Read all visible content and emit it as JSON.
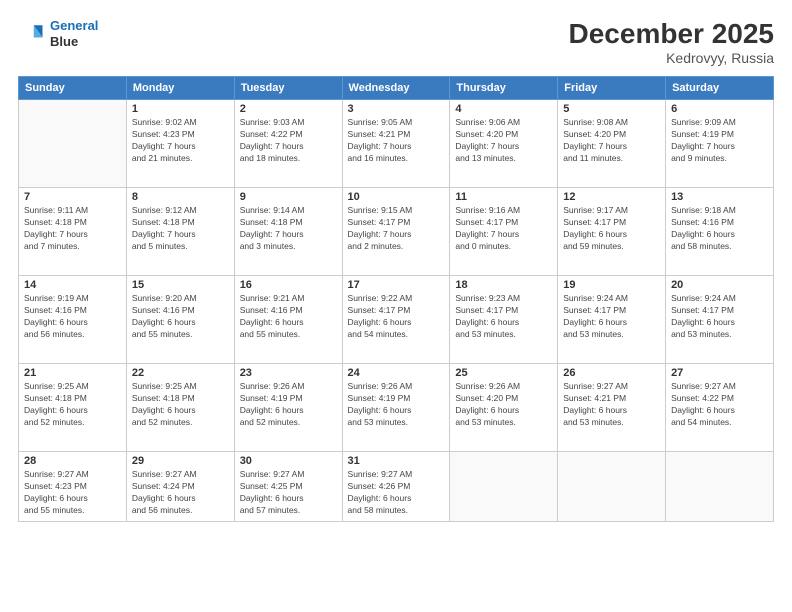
{
  "logo": {
    "line1": "General",
    "line2": "Blue"
  },
  "title": "December 2025",
  "subtitle": "Kedrovyy, Russia",
  "weekdays": [
    "Sunday",
    "Monday",
    "Tuesday",
    "Wednesday",
    "Thursday",
    "Friday",
    "Saturday"
  ],
  "weeks": [
    [
      {
        "day": "",
        "info": ""
      },
      {
        "day": "1",
        "info": "Sunrise: 9:02 AM\nSunset: 4:23 PM\nDaylight: 7 hours\nand 21 minutes."
      },
      {
        "day": "2",
        "info": "Sunrise: 9:03 AM\nSunset: 4:22 PM\nDaylight: 7 hours\nand 18 minutes."
      },
      {
        "day": "3",
        "info": "Sunrise: 9:05 AM\nSunset: 4:21 PM\nDaylight: 7 hours\nand 16 minutes."
      },
      {
        "day": "4",
        "info": "Sunrise: 9:06 AM\nSunset: 4:20 PM\nDaylight: 7 hours\nand 13 minutes."
      },
      {
        "day": "5",
        "info": "Sunrise: 9:08 AM\nSunset: 4:20 PM\nDaylight: 7 hours\nand 11 minutes."
      },
      {
        "day": "6",
        "info": "Sunrise: 9:09 AM\nSunset: 4:19 PM\nDaylight: 7 hours\nand 9 minutes."
      }
    ],
    [
      {
        "day": "7",
        "info": "Sunrise: 9:11 AM\nSunset: 4:18 PM\nDaylight: 7 hours\nand 7 minutes."
      },
      {
        "day": "8",
        "info": "Sunrise: 9:12 AM\nSunset: 4:18 PM\nDaylight: 7 hours\nand 5 minutes."
      },
      {
        "day": "9",
        "info": "Sunrise: 9:14 AM\nSunset: 4:18 PM\nDaylight: 7 hours\nand 3 minutes."
      },
      {
        "day": "10",
        "info": "Sunrise: 9:15 AM\nSunset: 4:17 PM\nDaylight: 7 hours\nand 2 minutes."
      },
      {
        "day": "11",
        "info": "Sunrise: 9:16 AM\nSunset: 4:17 PM\nDaylight: 7 hours\nand 0 minutes."
      },
      {
        "day": "12",
        "info": "Sunrise: 9:17 AM\nSunset: 4:17 PM\nDaylight: 6 hours\nand 59 minutes."
      },
      {
        "day": "13",
        "info": "Sunrise: 9:18 AM\nSunset: 4:16 PM\nDaylight: 6 hours\nand 58 minutes."
      }
    ],
    [
      {
        "day": "14",
        "info": "Sunrise: 9:19 AM\nSunset: 4:16 PM\nDaylight: 6 hours\nand 56 minutes."
      },
      {
        "day": "15",
        "info": "Sunrise: 9:20 AM\nSunset: 4:16 PM\nDaylight: 6 hours\nand 55 minutes."
      },
      {
        "day": "16",
        "info": "Sunrise: 9:21 AM\nSunset: 4:16 PM\nDaylight: 6 hours\nand 55 minutes."
      },
      {
        "day": "17",
        "info": "Sunrise: 9:22 AM\nSunset: 4:17 PM\nDaylight: 6 hours\nand 54 minutes."
      },
      {
        "day": "18",
        "info": "Sunrise: 9:23 AM\nSunset: 4:17 PM\nDaylight: 6 hours\nand 53 minutes."
      },
      {
        "day": "19",
        "info": "Sunrise: 9:24 AM\nSunset: 4:17 PM\nDaylight: 6 hours\nand 53 minutes."
      },
      {
        "day": "20",
        "info": "Sunrise: 9:24 AM\nSunset: 4:17 PM\nDaylight: 6 hours\nand 53 minutes."
      }
    ],
    [
      {
        "day": "21",
        "info": "Sunrise: 9:25 AM\nSunset: 4:18 PM\nDaylight: 6 hours\nand 52 minutes."
      },
      {
        "day": "22",
        "info": "Sunrise: 9:25 AM\nSunset: 4:18 PM\nDaylight: 6 hours\nand 52 minutes."
      },
      {
        "day": "23",
        "info": "Sunrise: 9:26 AM\nSunset: 4:19 PM\nDaylight: 6 hours\nand 52 minutes."
      },
      {
        "day": "24",
        "info": "Sunrise: 9:26 AM\nSunset: 4:19 PM\nDaylight: 6 hours\nand 53 minutes."
      },
      {
        "day": "25",
        "info": "Sunrise: 9:26 AM\nSunset: 4:20 PM\nDaylight: 6 hours\nand 53 minutes."
      },
      {
        "day": "26",
        "info": "Sunrise: 9:27 AM\nSunset: 4:21 PM\nDaylight: 6 hours\nand 53 minutes."
      },
      {
        "day": "27",
        "info": "Sunrise: 9:27 AM\nSunset: 4:22 PM\nDaylight: 6 hours\nand 54 minutes."
      }
    ],
    [
      {
        "day": "28",
        "info": "Sunrise: 9:27 AM\nSunset: 4:23 PM\nDaylight: 6 hours\nand 55 minutes."
      },
      {
        "day": "29",
        "info": "Sunrise: 9:27 AM\nSunset: 4:24 PM\nDaylight: 6 hours\nand 56 minutes."
      },
      {
        "day": "30",
        "info": "Sunrise: 9:27 AM\nSunset: 4:25 PM\nDaylight: 6 hours\nand 57 minutes."
      },
      {
        "day": "31",
        "info": "Sunrise: 9:27 AM\nSunset: 4:26 PM\nDaylight: 6 hours\nand 58 minutes."
      },
      {
        "day": "",
        "info": ""
      },
      {
        "day": "",
        "info": ""
      },
      {
        "day": "",
        "info": ""
      }
    ]
  ]
}
